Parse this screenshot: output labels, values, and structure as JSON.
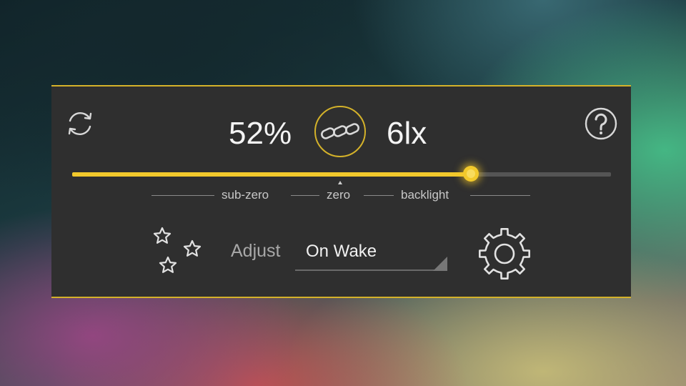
{
  "widget": {
    "brightness": "52%",
    "lux": "6lx",
    "slider": {
      "level_percent": 74
    },
    "scale_labels": [
      "sub-zero",
      "zero",
      "backlight"
    ],
    "adjust": {
      "label": "Adjust",
      "value": "On Wake"
    },
    "accent_color": "#f2c92c",
    "border_color": "#d4b22a",
    "panel_color": "#2f2f2f"
  },
  "icons": {
    "refresh": "refresh-icon",
    "help": "question-mark-icon",
    "link": "chain-link-icon",
    "stars": "stars-icon",
    "settings": "gear-icon"
  }
}
